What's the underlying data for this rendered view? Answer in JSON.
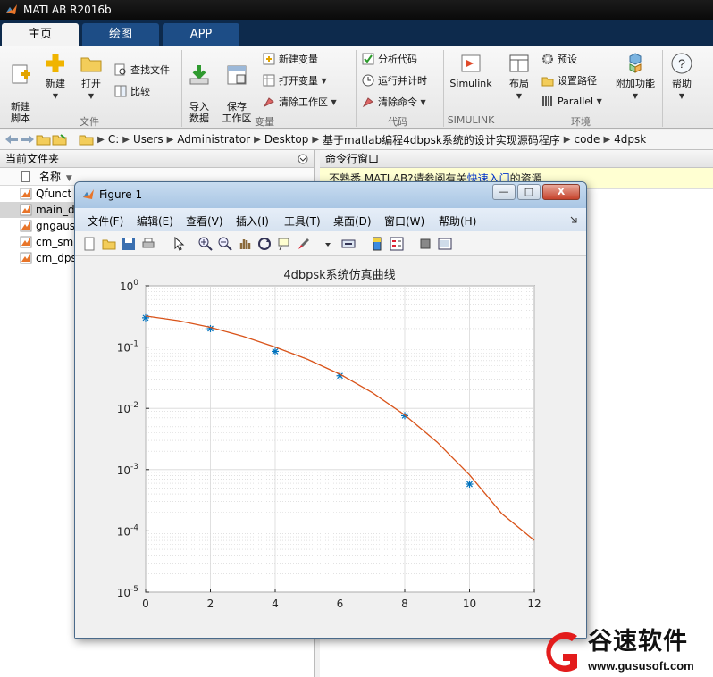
{
  "app": {
    "title": "MATLAB R2016b"
  },
  "ribbon_tabs": [
    {
      "label": "主页"
    },
    {
      "label": "绘图"
    },
    {
      "label": "APP"
    }
  ],
  "ribbon": {
    "new_script": "新建\n脚本",
    "new": "新建",
    "open": "打开",
    "find_files": "查找文件",
    "compare": "比较",
    "import_data": "导入\n数据",
    "save_workspace": "保存\n工作区",
    "new_variable": "新建变量",
    "open_variable": "打开变量",
    "clear_workspace": "清除工作区",
    "analyze_code": "分析代码",
    "run_and_time": "运行并计时",
    "clear_commands": "清除命令",
    "simulink": "Simulink",
    "layout": "布局",
    "preferences": "预设",
    "set_path": "设置路径",
    "parallel": "Parallel",
    "addons": "附加功能",
    "help": "帮助",
    "sections": {
      "file": "文件",
      "variable": "变量",
      "code": "代码",
      "simulink": "SIMULINK",
      "environment": "环境"
    }
  },
  "address": [
    "C:",
    "Users",
    "Administrator",
    "Desktop",
    "基于matlab编程4dbpsk系统的设计实现源码程序",
    "code",
    "4dpsk"
  ],
  "current_folder": {
    "title": "当前文件夹",
    "column_name": "名称",
    "sort_indicator": "▼",
    "files": [
      "Qfunct",
      "main_d",
      "gngaus",
      "cm_sm",
      "cm_dps"
    ]
  },
  "command_window": {
    "title": "命令行窗口",
    "banner_prefix": "不熟悉 MATLAB?请参阅有关",
    "banner_link": "快速入门",
    "banner_suffix": "的资源"
  },
  "figure": {
    "title": "Figure 1",
    "menu": [
      "文件(F)",
      "编辑(E)",
      "查看(V)",
      "插入(I)",
      "工具(T)",
      "桌面(D)",
      "窗口(W)",
      "帮助(H)"
    ],
    "window_buttons": {
      "minimize": "—",
      "maximize": "□",
      "close": "X"
    }
  },
  "chart_data": {
    "type": "line",
    "title": "4dbpsk系统仿真曲线",
    "xlabel": "",
    "ylabel": "",
    "xlim": [
      0,
      12
    ],
    "ylim": [
      1e-05,
      1
    ],
    "yscale": "log",
    "grid": true,
    "x_ticks": [
      0,
      2,
      4,
      6,
      8,
      10,
      12
    ],
    "y_tick_exponents": [
      0,
      -1,
      -2,
      -3,
      -4,
      -5
    ],
    "series": [
      {
        "style": "markers",
        "marker": "*",
        "color": "#0072bd",
        "x": [
          0,
          2,
          4,
          6,
          8,
          10
        ],
        "y": [
          0.3,
          0.2,
          0.085,
          0.034,
          0.0076,
          0.00058
        ]
      },
      {
        "style": "line",
        "color": "#d95319",
        "x": [
          0,
          1,
          2,
          3,
          4,
          5,
          6,
          7,
          8,
          9,
          10,
          11,
          12
        ],
        "y": [
          0.32,
          0.27,
          0.21,
          0.15,
          0.1,
          0.063,
          0.036,
          0.018,
          0.0078,
          0.0028,
          0.00082,
          0.00019,
          7e-05
        ]
      }
    ]
  },
  "watermark": {
    "brand": "谷速软件",
    "url": "www.gususoft.com"
  }
}
